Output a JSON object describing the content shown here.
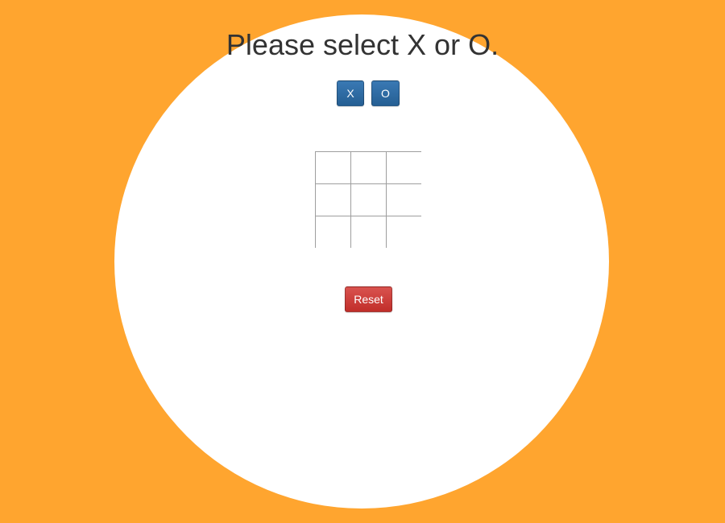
{
  "page": {
    "title": "Please select X or O.",
    "background_color": "#ffa52f"
  },
  "choice": {
    "x_label": "X",
    "o_label": "O",
    "button_color": "#2c6aa3"
  },
  "board": {
    "cells": [
      "",
      "",
      "",
      "",
      "",
      "",
      "",
      "",
      ""
    ]
  },
  "controls": {
    "reset_label": "Reset",
    "reset_color": "#d43f3a"
  }
}
